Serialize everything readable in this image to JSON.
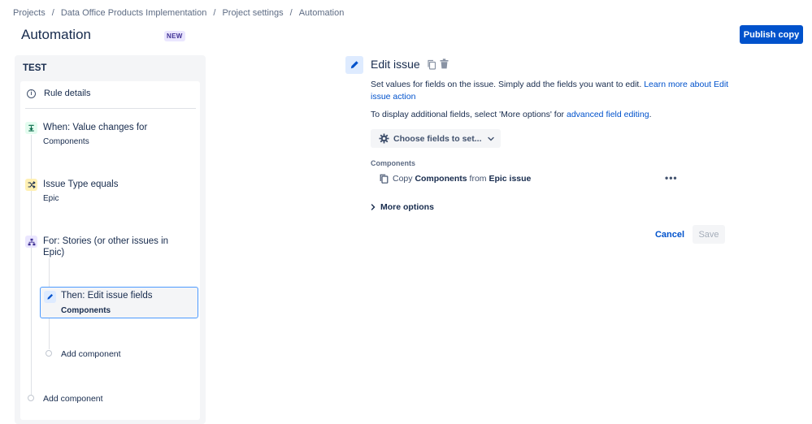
{
  "breadcrumb": {
    "items": [
      "Projects",
      "Data Office Products Implementation",
      "Project settings",
      "Automation"
    ],
    "separator": "/"
  },
  "page": {
    "title": "Automation",
    "badge": "NEW",
    "publish_label": "Publish copy"
  },
  "rule": {
    "name": "TEST",
    "details_label": "Rule details",
    "steps": [
      {
        "title": "When: Value changes for",
        "subtitle": "Components",
        "icon": "trigger-icon",
        "color": "#57d9a3"
      },
      {
        "title": "Issue Type equals",
        "subtitle": "Epic",
        "icon": "shuffle-icon",
        "color": "#ffe380"
      },
      {
        "title": "For: Stories (or other issues in",
        "title2": "Epic)",
        "icon": "branch-icon",
        "color": "#c0b6f2"
      },
      {
        "title": "Then: Edit issue fields",
        "subtitle": "Components",
        "icon": "pencil-icon",
        "color": "#0052cc"
      }
    ],
    "add_component_inner": "Add component",
    "add_component_outer": "Add component"
  },
  "editor": {
    "title": "Edit issue",
    "description": "Set values for fields on the issue. Simply add the fields you want to edit.",
    "learn_more": "Learn more about Edit issue action",
    "display_text": "To display additional fields, select 'More options' for",
    "advanced_link": "advanced field editing",
    "choose_fields_label": "Choose fields to set...",
    "field_label": "Components",
    "copy_prefix": "Copy",
    "copy_field": "Components",
    "copy_from": "from",
    "copy_source": "Epic issue",
    "more_dots": "•••",
    "more_options_label": "More options",
    "cancel_label": "Cancel",
    "save_label": "Save"
  },
  "colors": {
    "accent": "#0052cc",
    "selected_border": "#4c9aff"
  }
}
